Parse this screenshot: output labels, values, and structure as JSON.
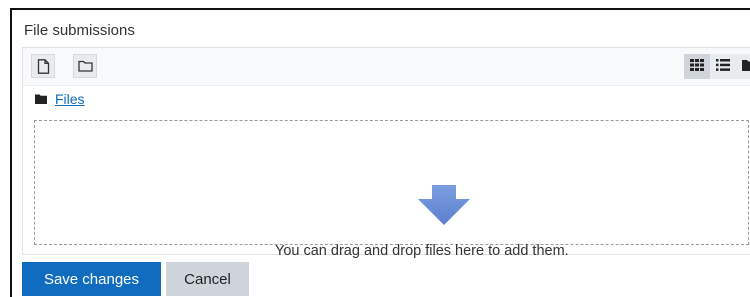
{
  "section": {
    "title": "File submissions"
  },
  "filemanager": {
    "toolbar": {
      "add_file_icon": "file-icon",
      "create_folder_icon": "folder-icon",
      "views": [
        {
          "icon": "grid-view-icon",
          "active": true
        },
        {
          "icon": "list-view-icon",
          "active": false
        },
        {
          "icon": "tree-view-icon",
          "active": false
        }
      ]
    },
    "path": {
      "icon": "folder-icon",
      "label": "Files"
    },
    "dropzone": {
      "icon": "arrow-down-icon",
      "message": "You can drag and drop files here to add them."
    }
  },
  "actions": {
    "save_label": "Save changes",
    "cancel_label": "Cancel"
  },
  "colors": {
    "primary": "#0f6cbf",
    "secondary": "#ced4da",
    "arrow": "#6b8fd6"
  }
}
